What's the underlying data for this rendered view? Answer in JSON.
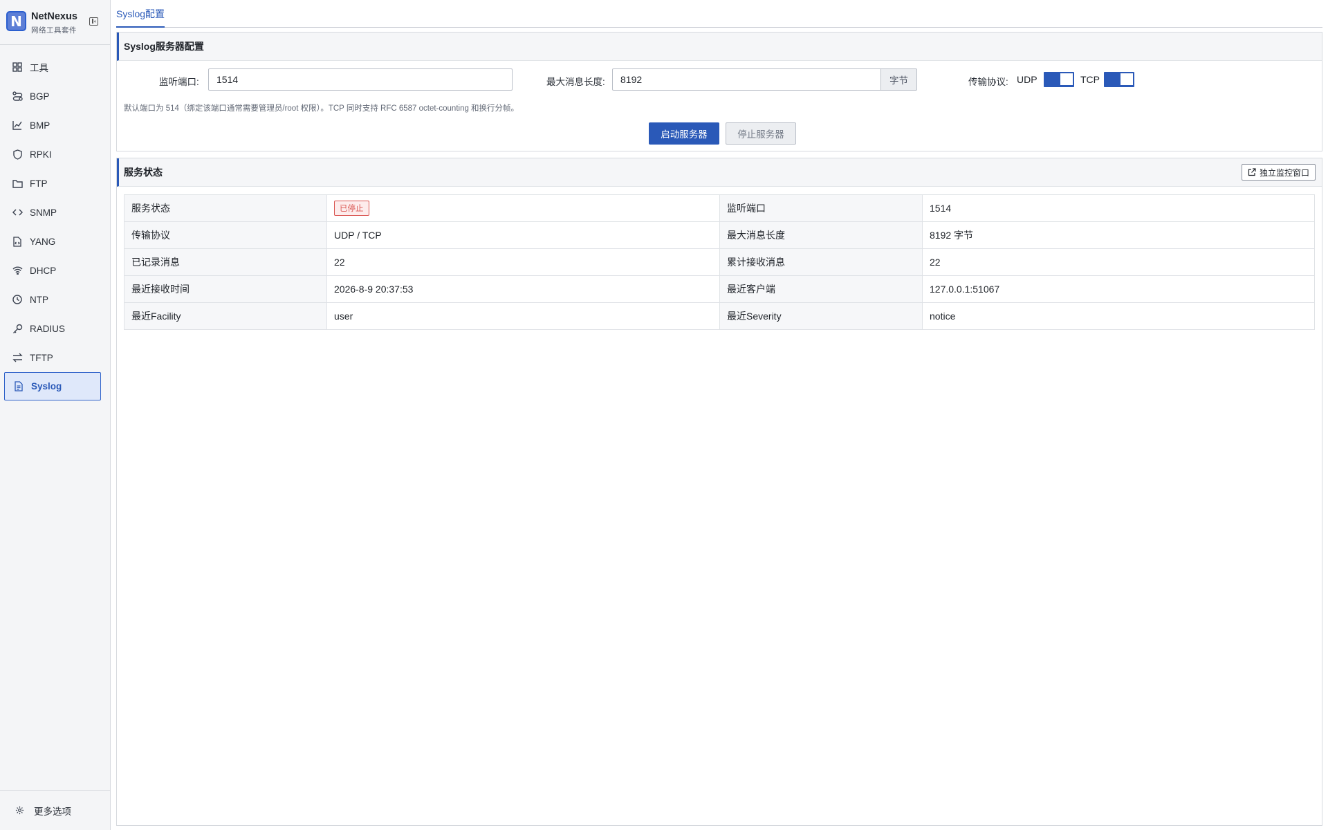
{
  "brand": {
    "name": "NetNexus",
    "subtitle": "网络工具套件",
    "logo_letter": "N"
  },
  "sidebar": {
    "items": [
      {
        "label": "工具",
        "icon": "grid-icon"
      },
      {
        "label": "BGP",
        "icon": "route-icon"
      },
      {
        "label": "BMP",
        "icon": "chart-icon"
      },
      {
        "label": "RPKI",
        "icon": "shield-icon"
      },
      {
        "label": "FTP",
        "icon": "folder-icon"
      },
      {
        "label": "SNMP",
        "icon": "code-icon"
      },
      {
        "label": "YANG",
        "icon": "file-code-icon"
      },
      {
        "label": "DHCP",
        "icon": "wifi-icon"
      },
      {
        "label": "NTP",
        "icon": "clock-icon"
      },
      {
        "label": "RADIUS",
        "icon": "key-icon"
      },
      {
        "label": "TFTP",
        "icon": "transfer-icon"
      },
      {
        "label": "Syslog",
        "icon": "document-icon",
        "active": true
      }
    ],
    "footer_label": "更多选项"
  },
  "tabs": [
    {
      "label": "Syslog配置",
      "active": true
    }
  ],
  "config": {
    "title": "Syslog服务器配置",
    "port_label": "监听端口:",
    "port_value": "1514",
    "maxlen_label": "最大消息长度:",
    "maxlen_value": "8192",
    "maxlen_unit": "字节",
    "protocol_label": "传输协议:",
    "udp_label": "UDP",
    "udp_on": true,
    "tcp_label": "TCP",
    "tcp_on": true,
    "hint": "默认端口为 514（绑定该端口通常需要管理员/root 权限）。TCP 同时支持 RFC 6587 octet-counting 和换行分帧。",
    "start_label": "启动服务器",
    "stop_label": "停止服务器"
  },
  "status": {
    "title": "服务状态",
    "monitor_label": "独立监控窗口",
    "rows": [
      {
        "k1": "服务状态",
        "v1": "已停止",
        "k2": "监听端口",
        "v2": "1514"
      },
      {
        "k1": "传输协议",
        "v1": "UDP / TCP",
        "k2": "最大消息长度",
        "v2": "8192 字节"
      },
      {
        "k1": "已记录消息",
        "v1": "22",
        "k2": "累计接收消息",
        "v2": "22"
      },
      {
        "k1": "最近接收时间",
        "v1": "2026-8-9 20:37:53",
        "k2": "最近客户端",
        "v2": "127.0.0.1:51067"
      },
      {
        "k1": "最近Facility",
        "v1": "user",
        "k2": "最近Severity",
        "v2": "notice"
      }
    ]
  },
  "colors": {
    "accent": "#2a59b8",
    "stopped": "#d9534f"
  }
}
